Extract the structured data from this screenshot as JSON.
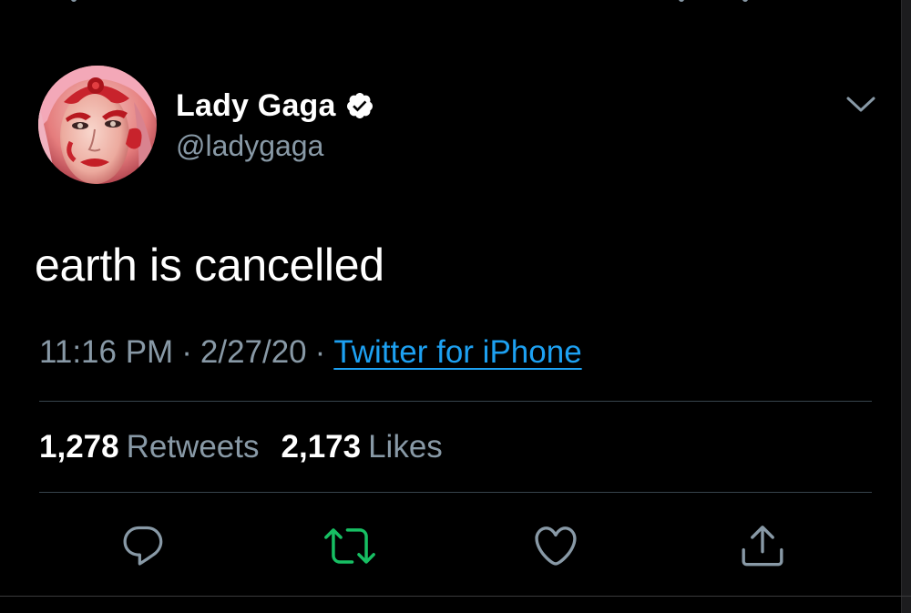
{
  "tweet": {
    "author": {
      "display_name": "Lady Gaga",
      "handle": "@ladygaga",
      "verified": true
    },
    "text": "earth is cancelled",
    "time": "11:16 PM",
    "date": "2/27/20",
    "separator": "·",
    "source": "Twitter for iPhone",
    "stats": {
      "retweets_count": "1,278",
      "retweets_label": "Retweets",
      "likes_count": "2,173",
      "likes_label": "Likes"
    },
    "actions": [
      {
        "name": "reply",
        "icon": "reply-icon"
      },
      {
        "name": "retweet",
        "icon": "retweet-icon",
        "active": true
      },
      {
        "name": "like",
        "icon": "heart-icon"
      },
      {
        "name": "share",
        "icon": "share-icon"
      }
    ]
  },
  "colors": {
    "background": "#000000",
    "text_primary": "#ffffff",
    "text_secondary": "#8899a6",
    "link": "#1da1f2",
    "retweet_active": "#17bf63",
    "divider": "#38444d"
  }
}
